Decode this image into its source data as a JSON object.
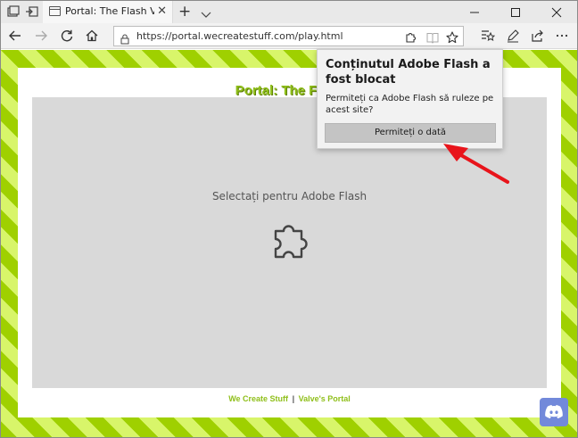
{
  "browser": {
    "tab": {
      "title": "Portal: The Flash Version"
    },
    "address": {
      "url": "https://portal.wecreatestuff.com/play.html"
    },
    "icons": {
      "tab_actions": "set-aside-tabs-icon",
      "restore_tabs": "restore-tabs-icon",
      "new_tab": "+",
      "close_tab": "✕"
    }
  },
  "page": {
    "heading": "Portal: The Flash",
    "flash_placeholder": "Selectați pentru Adobe Flash",
    "footer": {
      "link_left": "We Create Stuff",
      "separator": "|",
      "link_right": "Valve's Portal"
    }
  },
  "popup": {
    "title": "Conținutul Adobe Flash a fost blocat",
    "message": "Permiteți ca Adobe Flash să ruleze pe acest site?",
    "button": "Permiteți o dată"
  },
  "colors": {
    "stripe_dark": "#9fd000",
    "stripe_light": "#d8f56a",
    "heading_green": "#8fbf1a",
    "discord": "#7289da",
    "arrow_red": "#e8141b"
  }
}
